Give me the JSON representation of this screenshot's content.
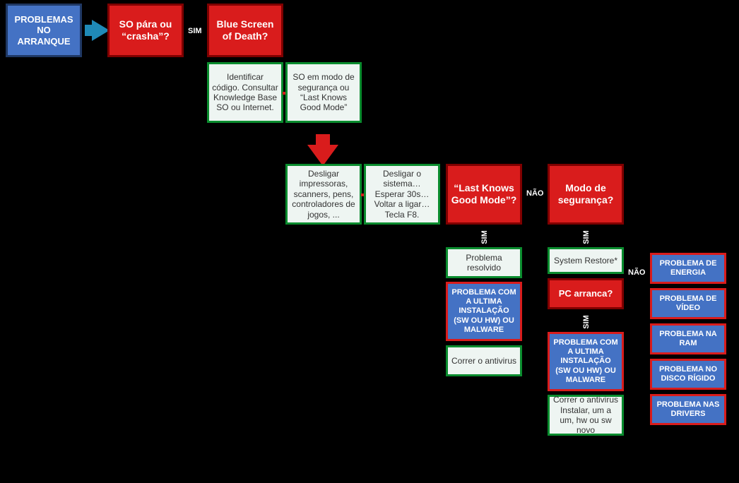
{
  "startNode": "PROBLEMAS NO ARRANQUE",
  "q1": "SO pára ou “crasha”?",
  "q2": "Blue Screen of Death?",
  "q3": "“Last Knows Good Mode”?",
  "q4": "Modo de segurança?",
  "q5": "PC arranca?",
  "info1": "Identificar código. Consultar Knowledge Base SO ou Internet.",
  "info2": "SO em modo de segurança ou “Last Knows Good Mode”",
  "info3": "Desligar impressoras, scanners, pens, controladores de jogos, ...",
  "info4": "Desligar o sistema… Esperar 30s… Voltar a ligar… Tecla F8.",
  "info5": "Problema resolvido",
  "info6": "Correr o antivirus",
  "info7": "System Restore*",
  "info8": "Correr o antivirus Instalar, um a um, hw ou sw novo",
  "outcome1": "PROBLEMA COM A ULTIMA INSTALAÇÃO (SW OU HW) OU MALWARE",
  "outcome2": "PROBLEMA COM A ULTIMA INSTALAÇÃO (SW OU HW) OU MALWARE",
  "rightProblems": {
    "energia": "PROBLEMA DE ENERGIA",
    "video": "PROBLEMA DE VÍDEO",
    "ram": "PROBLEMA NA RAM",
    "disco": "PROBLEMA NO DISCO RÍGIDO",
    "drivers": "PROBLEMA NAS DRIVERS"
  },
  "labels": {
    "sim": "SIM",
    "nao": "NÃO"
  }
}
